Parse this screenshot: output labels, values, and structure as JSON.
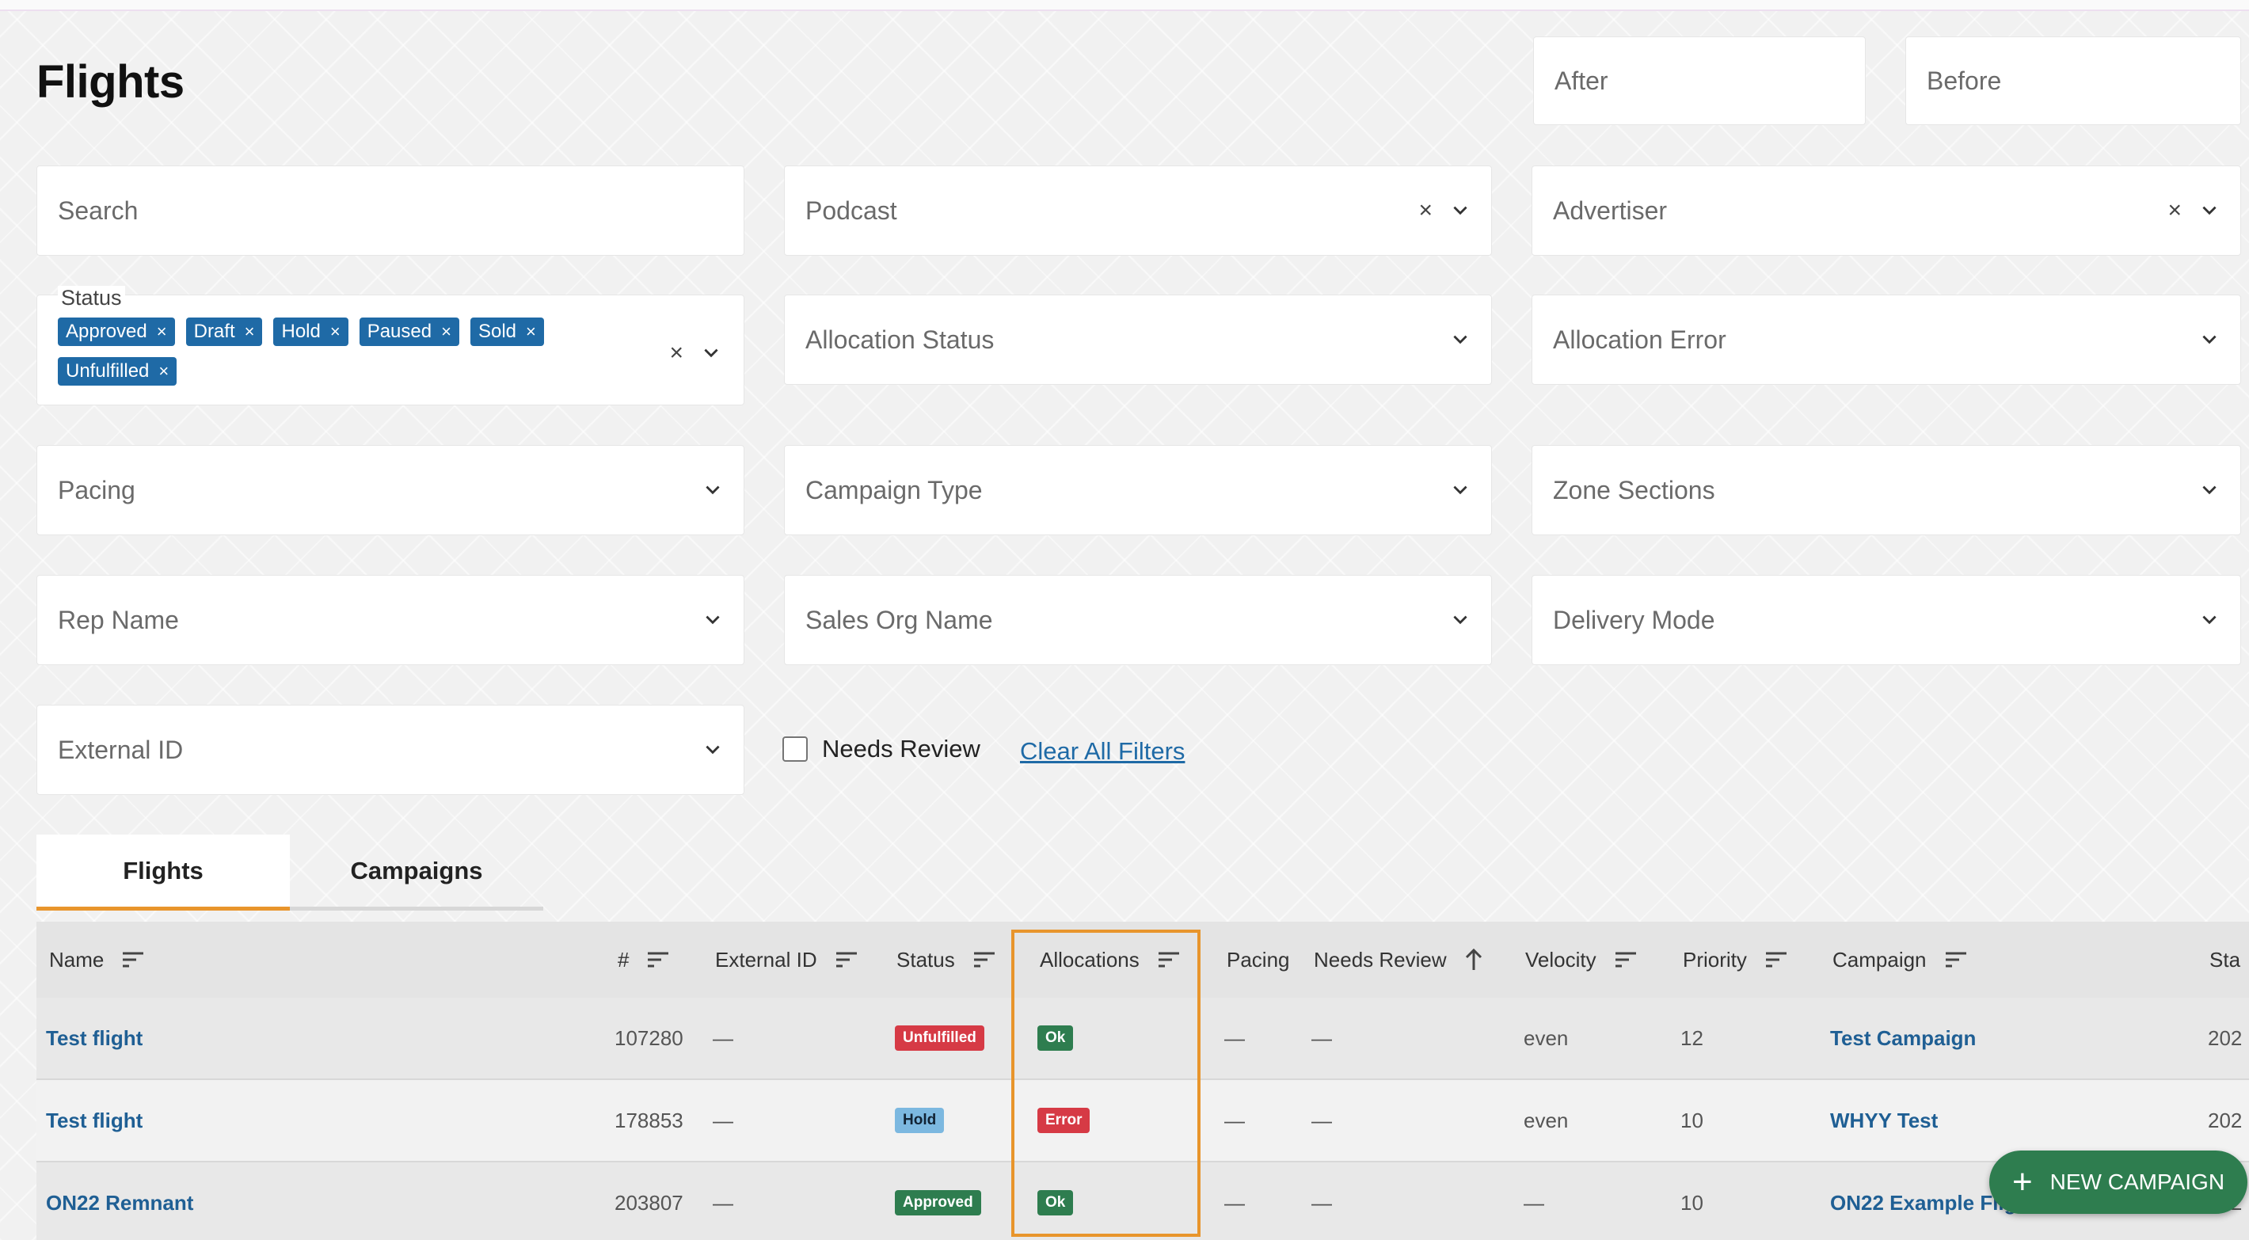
{
  "page": {
    "title": "Flights"
  },
  "filters": {
    "after": "After",
    "before": "Before",
    "search": "Search",
    "podcast": "Podcast",
    "advertiser": "Advertiser",
    "status_label": "Status",
    "status_chips": [
      "Approved",
      "Draft",
      "Hold",
      "Paused",
      "Sold",
      "Unfulfilled"
    ],
    "allocation_status": "Allocation Status",
    "allocation_error": "Allocation Error",
    "pacing": "Pacing",
    "campaign_type": "Campaign Type",
    "zone_sections": "Zone Sections",
    "rep_name": "Rep Name",
    "sales_org_name": "Sales Org Name",
    "delivery_mode": "Delivery Mode",
    "external_id": "External ID",
    "needs_review": "Needs Review",
    "clear_all": "Clear All Filters",
    "clear_symbol": "×",
    "chip_remove_symbol": "×"
  },
  "tabs": [
    "Flights",
    "Campaigns"
  ],
  "table": {
    "columns": [
      "Name",
      "#",
      "External ID",
      "Status",
      "Allocations",
      "Pacing",
      "Needs Review",
      "Velocity",
      "Priority",
      "Campaign",
      "Sta"
    ],
    "rows": [
      {
        "name": "Test flight",
        "number": "107280",
        "external_id": "—",
        "status": "Unfulfilled",
        "allocations": "Ok",
        "pacing": "—",
        "needs_review": "—",
        "velocity": "even",
        "priority": "12",
        "campaign": "Test Campaign",
        "start": "202"
      },
      {
        "name": "Test flight",
        "number": "178853",
        "external_id": "—",
        "status": "Hold",
        "allocations": "Error",
        "pacing": "—",
        "needs_review": "—",
        "velocity": "even",
        "priority": "10",
        "campaign": "WHYY Test",
        "start": "202"
      },
      {
        "name": "ON22 Remnant",
        "number": "203807",
        "external_id": "—",
        "status": "Approved",
        "allocations": "Ok",
        "pacing": "—",
        "needs_review": "—",
        "velocity": "—",
        "priority": "10",
        "campaign": "ON22 Example Flig",
        "start": "202"
      }
    ]
  },
  "fab": {
    "plus": "+",
    "label": "NEW CAMPAIGN"
  },
  "colors": {
    "chip": "#1f6aa6",
    "unfulfilled": "#d63a45",
    "hold": "#7cb8e0",
    "approved": "#2e7d4f",
    "ok": "#2e7d4f",
    "error": "#d63a45",
    "highlight": "#e8952c",
    "fab": "#2e7d4f"
  }
}
